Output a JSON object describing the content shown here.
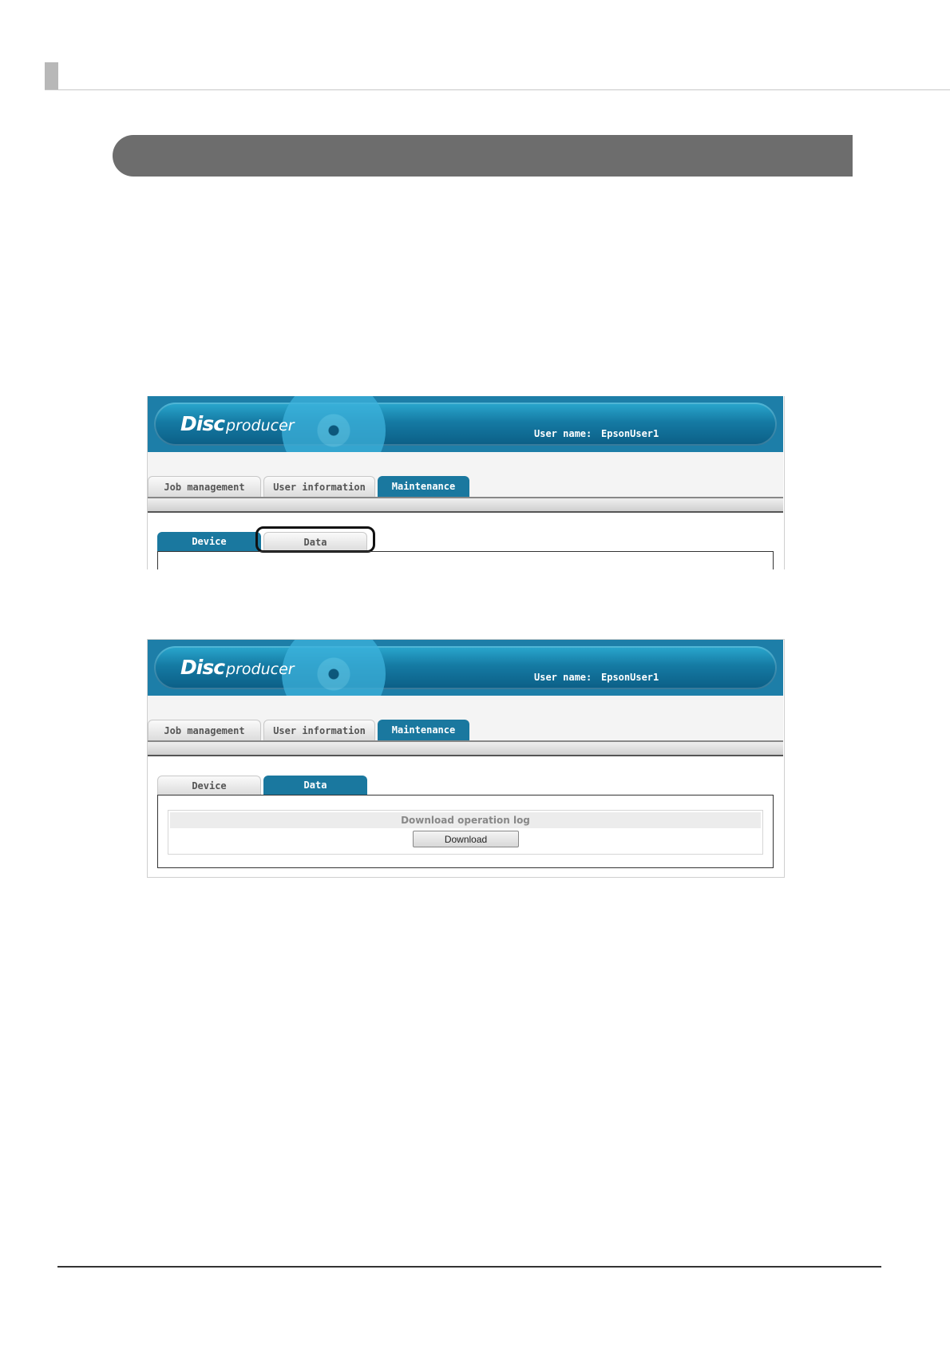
{
  "app": {
    "logo_disc": "Disc",
    "logo_producer": "producer",
    "user_label": "User name:",
    "user_value": "EpsonUser1"
  },
  "tabs": [
    "Job management",
    "User information",
    "Maintenance"
  ],
  "subtabs": [
    "Device",
    "Data"
  ],
  "panel": {
    "title": "Download operation log",
    "button": "Download"
  },
  "colors": {
    "brand": "#1a789f",
    "title_bar": "#6d6d6d"
  }
}
